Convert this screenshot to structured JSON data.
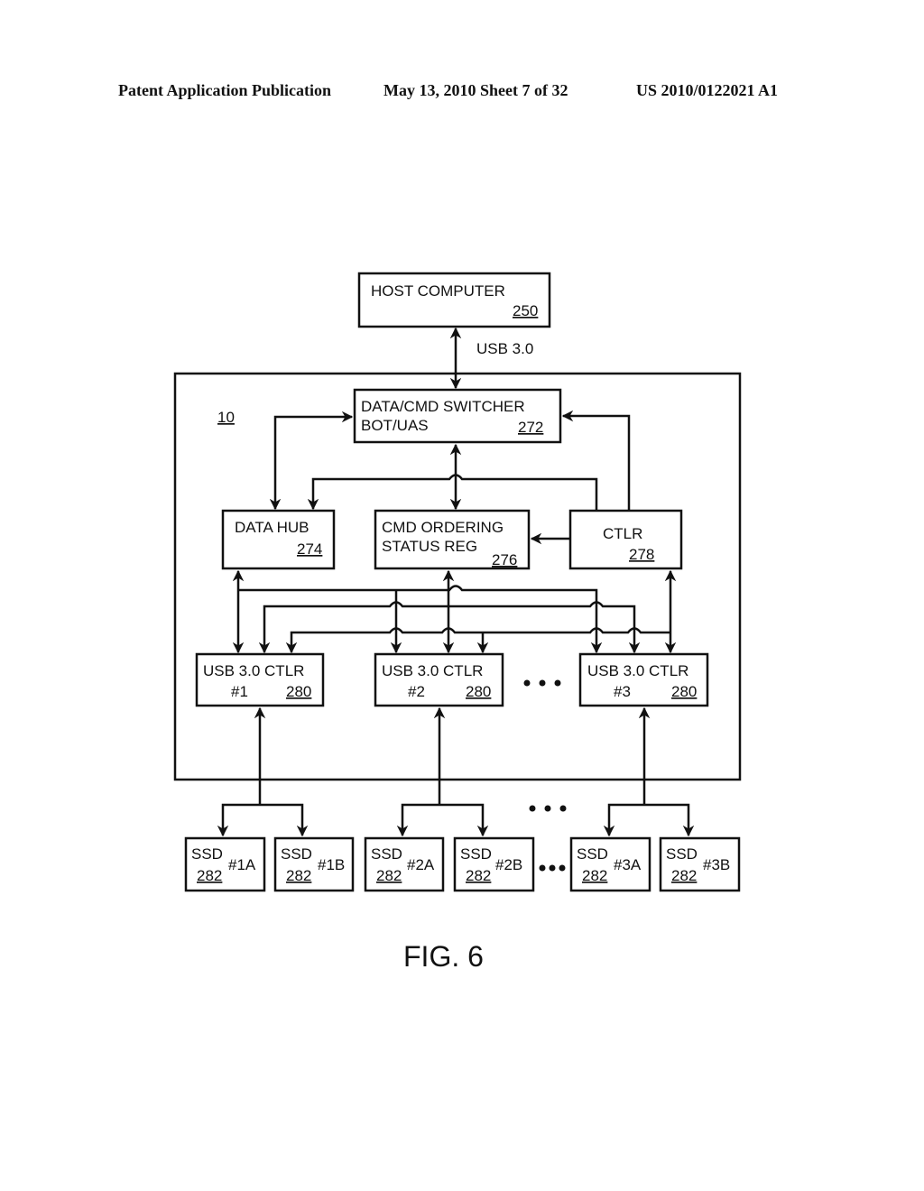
{
  "header": {
    "publication": "Patent Application Publication",
    "date_sheet": "May 13, 2010  Sheet 7 of 32",
    "number": "US 2010/0122021 A1"
  },
  "figure": {
    "caption": "FIG. 6",
    "system_ref": "10",
    "host": {
      "label": "HOST COMPUTER",
      "ref": "250"
    },
    "link_label": "USB 3.0",
    "switcher": {
      "line1": "DATA/CMD SWITCHER",
      "line2": "BOT/UAS",
      "ref": "272"
    },
    "data_hub": {
      "label": "DATA HUB",
      "ref": "274"
    },
    "cmd_ordering": {
      "line1": "CMD ORDERING",
      "line2": "STATUS REG",
      "ref": "276"
    },
    "ctlr": {
      "label": "CTLR",
      "ref": "278"
    },
    "usb_ctlrs": [
      {
        "label": "USB 3.0 CTLR",
        "num": "#1",
        "ref": "280"
      },
      {
        "label": "USB 3.0 CTLR",
        "num": "#2",
        "ref": "280"
      },
      {
        "label": "USB 3.0 CTLR",
        "num": "#3",
        "ref": "280"
      }
    ],
    "ssds": [
      {
        "label": "SSD",
        "ref": "282",
        "id": "#1A"
      },
      {
        "label": "SSD",
        "ref": "282",
        "id": "#1B"
      },
      {
        "label": "SSD",
        "ref": "282",
        "id": "#2A"
      },
      {
        "label": "SSD",
        "ref": "282",
        "id": "#2B"
      },
      {
        "label": "SSD",
        "ref": "282",
        "id": "#3A"
      },
      {
        "label": "SSD",
        "ref": "282",
        "id": "#3B"
      }
    ]
  }
}
